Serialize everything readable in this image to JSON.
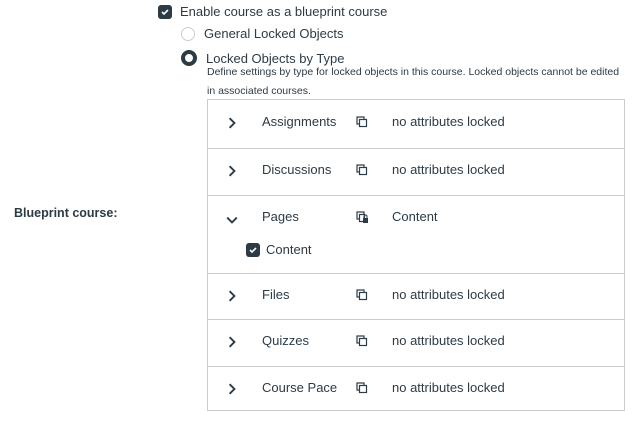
{
  "label": "Blueprint course:",
  "enable": {
    "label": "Enable course as a blueprint course",
    "checked": true
  },
  "options": [
    {
      "label": "General Locked Objects",
      "selected": false
    },
    {
      "label": "Locked Objects by Type",
      "selected": true
    }
  ],
  "description": "Define settings by type for locked objects in this course. Locked objects cannot be edited in associated courses.",
  "types": [
    {
      "name": "Assignments",
      "status": "no attributes locked"
    },
    {
      "name": "Discussions",
      "status": "no attributes locked"
    },
    {
      "name": "Pages",
      "status": "Content",
      "expanded": true,
      "attribute": "Content"
    },
    {
      "name": "Files",
      "status": "no attributes locked"
    },
    {
      "name": "Quizzes",
      "status": "no attributes locked"
    },
    {
      "name": "Course Pace",
      "status": "no attributes locked"
    }
  ]
}
